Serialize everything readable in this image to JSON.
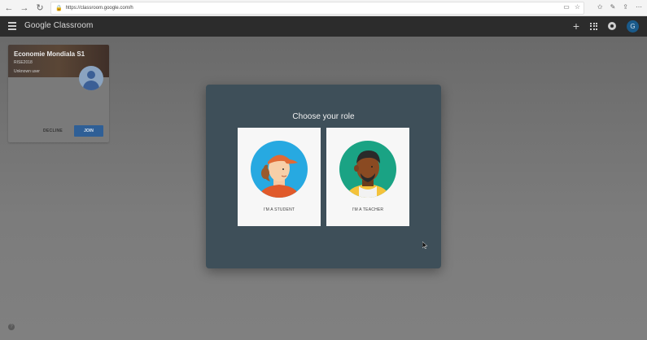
{
  "browser": {
    "url": "https://classroom.google.com/h",
    "nav": {
      "back": "←",
      "forward": "→",
      "reload": "↻"
    }
  },
  "header": {
    "brand": "Google Classroom",
    "avatar_letter": "G",
    "plus": "+"
  },
  "class_card": {
    "title": "Economie Mondiala S1",
    "section": "RISE2018",
    "owner": "Unknown user",
    "decline_label": "DECLINE",
    "join_label": "JOIN"
  },
  "dialog": {
    "title": "Choose your role",
    "roles": [
      {
        "label": "I'M A STUDENT"
      },
      {
        "label": "I'M A TEACHER"
      }
    ]
  },
  "help": {
    "glyph": "?"
  },
  "colors": {
    "student_bg": "#27a9e1",
    "teacher_bg": "#1aa384",
    "dialog_bg": "#3e4f59",
    "join_button": "#2f5f96"
  }
}
